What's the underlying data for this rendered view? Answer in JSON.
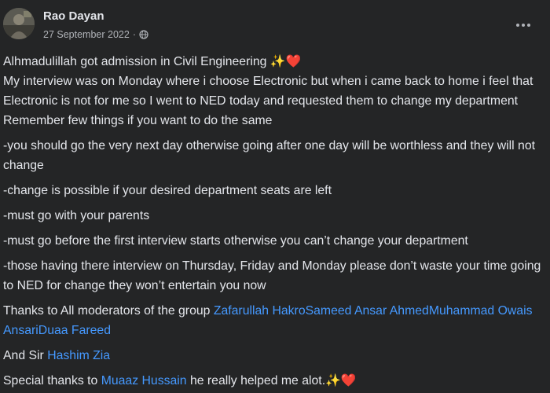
{
  "post": {
    "author": "Rao Dayan",
    "date": "27 September 2022",
    "separator": "·",
    "privacy_icon": "globe-icon",
    "menu_icon": "more-options-icon",
    "line1_text": "Alhmadulillah got admission in Civil Engineering ",
    "line1_emoji": "✨❤️",
    "line2": "My interview was on Monday where i choose Electronic but when i came back to home i feel that",
    "line3": "Electronic is not for me so I went to NED today and requested them to change my department",
    "line4": "Remember few things if you want to do the same",
    "tip1": "-you should go the very next day otherwise going after one day will be worthless and they will not change",
    "tip2": "-change is possible if your desired department seats are left",
    "tip3": "-must go with your parents",
    "tip4": "-must go before the first interview starts otherwise you can’t change your department",
    "tip5": "-those having there interview on Thursday, Friday and Monday please don’t waste your time going to NED for change they won’t entertain you now",
    "thanks_prefix": "Thanks to All moderators of the group ",
    "moderators": [
      "Zafarullah Hakro",
      "Sameed Ansar Ahmed",
      "Muhammad Owais Ansari",
      "Duaa Fareed"
    ],
    "sir_prefix": "And Sir ",
    "sir_name": "Hashim Zia",
    "special_prefix": "Special thanks to ",
    "special_name": "Muaaz Hussain",
    "special_suffix": " he really helped me alot.",
    "special_emoji": "✨❤️"
  },
  "colors": {
    "background": "#242526",
    "text": "#e4e6eb",
    "secondary": "#b0b3b8",
    "link": "#4599ff"
  }
}
